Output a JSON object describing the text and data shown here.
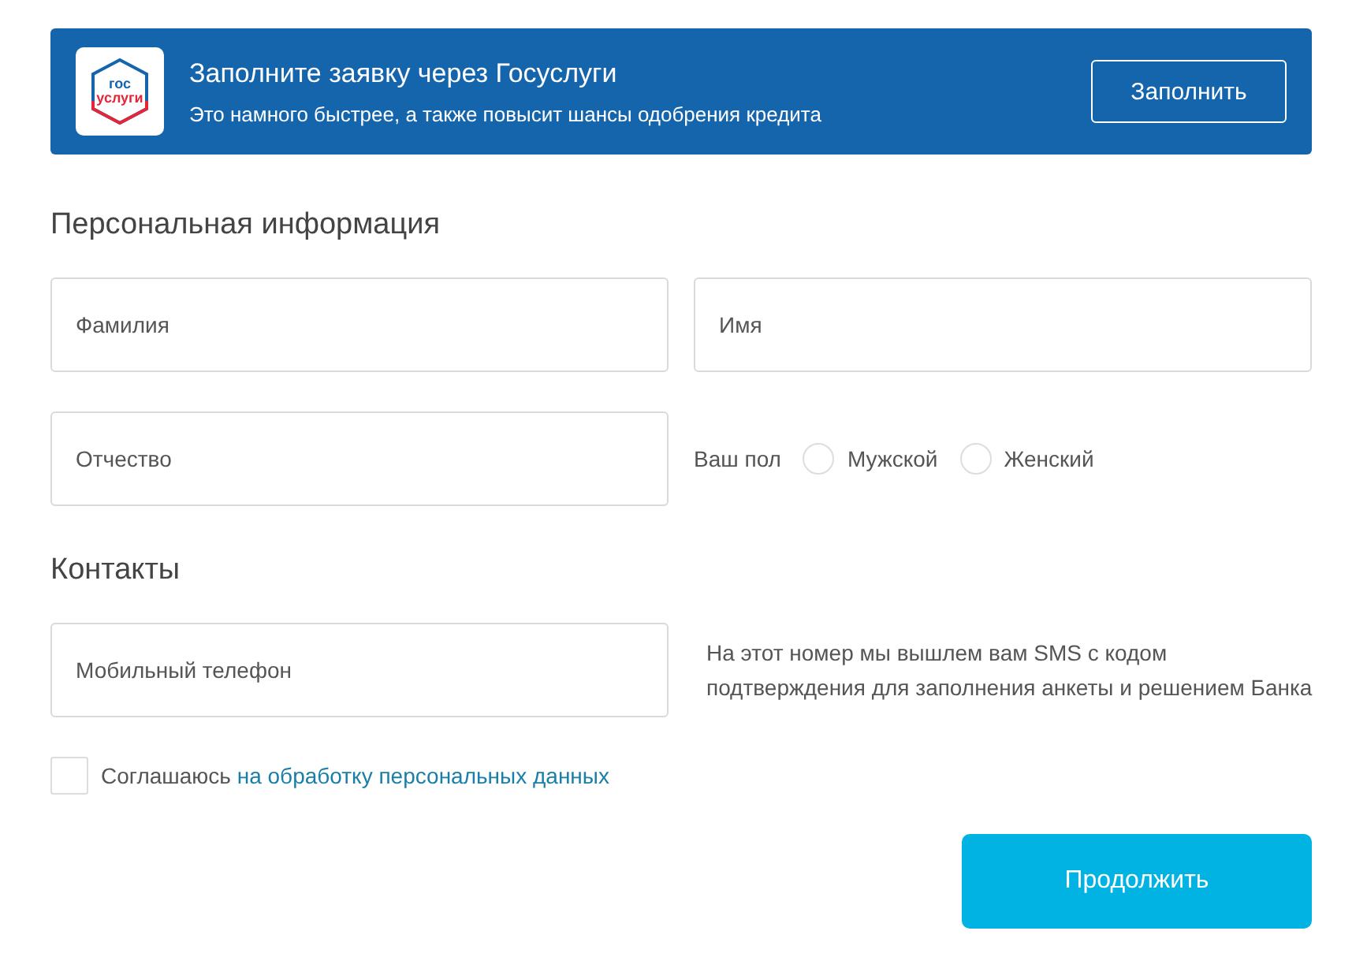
{
  "banner": {
    "logo": [
      "гос",
      "услуги"
    ],
    "title": "Заполните заявку через Госуслуги",
    "subtitle": "Это намного быстрее, а также повысит шансы одобрения кредита",
    "button": "Заполнить"
  },
  "personal": {
    "heading": "Персональная информация",
    "last_name": {
      "placeholder": "Фамилия"
    },
    "first_name": {
      "placeholder": "Имя"
    },
    "middle_name": {
      "placeholder": "Отчество"
    },
    "gender": {
      "label": "Ваш пол",
      "options": [
        {
          "label": "Мужской",
          "selected": false
        },
        {
          "label": "Женский",
          "selected": false
        }
      ]
    }
  },
  "contacts": {
    "heading": "Контакты",
    "phone": {
      "placeholder": "Мобильный телефон"
    },
    "hint": "На этот номер мы вышлем вам SMS с кодом подтверждения для заполнения анкеты и решением Банка"
  },
  "consent": {
    "checked": false,
    "text": "Соглашаюсь",
    "link": "на обработку персональных данных"
  },
  "submit": "Продолжить"
}
